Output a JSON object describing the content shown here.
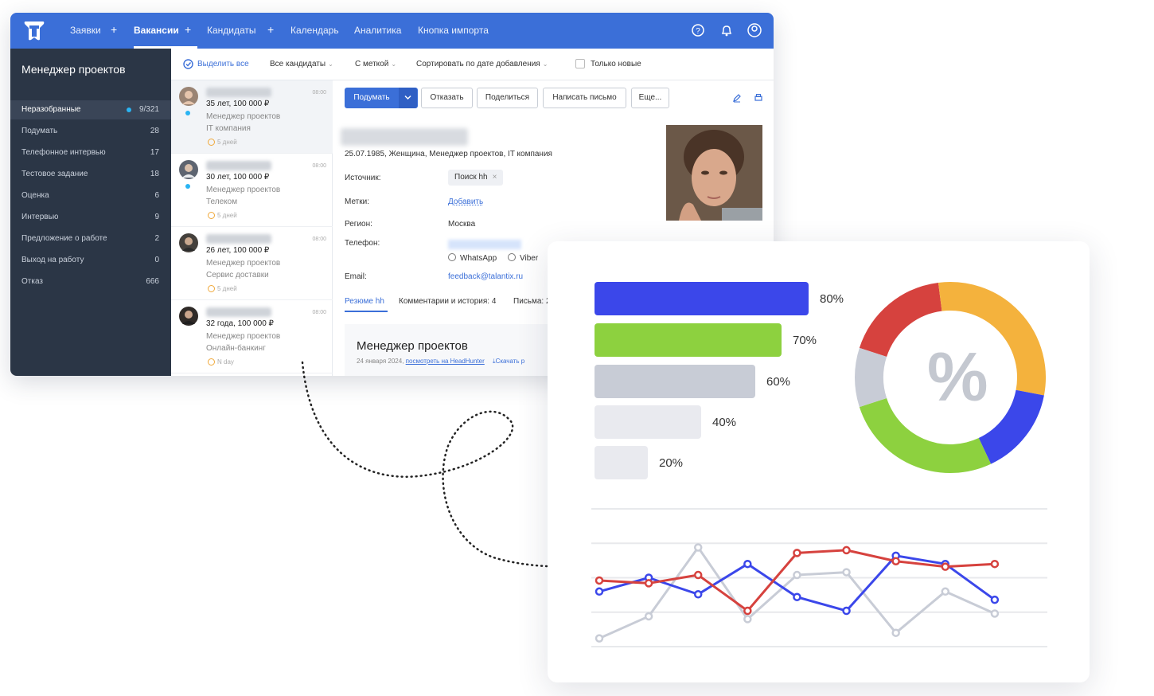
{
  "topnav": {
    "items": [
      "Заявки",
      "Вакансии",
      "Кандидаты",
      "Календарь",
      "Аналитика",
      "Кнопка импорта"
    ],
    "active": "Вакансии"
  },
  "sidebar": {
    "title": "Менеджер проектов",
    "items": [
      {
        "label": "Неразобранные",
        "count": "9/321"
      },
      {
        "label": "Подумать",
        "count": "28"
      },
      {
        "label": "Телефонное интервью",
        "count": "17"
      },
      {
        "label": "Тестовое задание",
        "count": "18"
      },
      {
        "label": "Оценка",
        "count": "6"
      },
      {
        "label": "Интервью",
        "count": "9"
      },
      {
        "label": "Предложение о работе",
        "count": "2"
      },
      {
        "label": "Выход на работу",
        "count": "0"
      },
      {
        "label": "Отказ",
        "count": "666"
      }
    ]
  },
  "toolbar": {
    "select_all": "Выделить все",
    "all_candidates": "Все кандидаты",
    "with_tag": "С меткой",
    "sort": "Сортировать по дате добавления",
    "only_new": "Только новые"
  },
  "candidates": [
    {
      "time": "08:00",
      "line1": "35 лет, 100 000 ₽",
      "position": "Менеджер проектов",
      "company": "IT компания",
      "age": "5 дней"
    },
    {
      "time": "08:00",
      "line1": "30 лет, 100 000 ₽",
      "position": "Менеджер проектов",
      "company": "Телеком",
      "age": "5 дней"
    },
    {
      "time": "08:00",
      "line1": "26 лет, 100 000 ₽",
      "position": "Менеджер проектов",
      "company": "Сервис доставки",
      "age": "5 дней"
    },
    {
      "time": "08:00",
      "line1": "32 года, 100 000 ₽",
      "position": "Менеджер проектов",
      "company": "Онлайн-банкинг",
      "age": "N day"
    }
  ],
  "actions": {
    "think": "Подумать",
    "reject": "Отказать",
    "share": "Поделиться",
    "write": "Написать письмо",
    "more": "Еще..."
  },
  "detail": {
    "meta": "25.07.1985, Женщина, Менеджер проектов, IT компания",
    "source_label": "Источник:",
    "source_value": "Поиск hh",
    "tags_label": "Метки:",
    "tags_add": "Добавить",
    "region_label": "Регион:",
    "region_value": "Москва",
    "phone_label": "Телефон:",
    "whatsapp": "WhatsApp",
    "viber": "Viber",
    "email_label": "Email:",
    "email_value": "feedback@talantix.ru",
    "tabs": [
      "Резюме hh",
      "Комментарии и история: 4",
      "Письма: 2"
    ],
    "resume_title": "Менеджер проектов",
    "resume_date": "24 января 2024,",
    "resume_link": "посмотреть на HeadHunter",
    "resume_download": "Скачать р"
  },
  "analytics": {
    "bars": [
      {
        "label": "80%",
        "value": 80,
        "color": "#3b47ea"
      },
      {
        "label": "70%",
        "value": 70,
        "color": "#8dd13f"
      },
      {
        "label": "60%",
        "value": 60,
        "color": "#c8ccd6"
      },
      {
        "label": "40%",
        "value": 40,
        "color": "#e9eaef"
      },
      {
        "label": "20%",
        "value": 20,
        "color": "#e9eaef"
      }
    ],
    "donut_symbol": "%",
    "donut": [
      {
        "value": 18,
        "color": "#d6423e"
      },
      {
        "value": 30,
        "color": "#f4b23d"
      },
      {
        "value": 15,
        "color": "#3b47ea"
      },
      {
        "value": 27,
        "color": "#8dd13f"
      },
      {
        "value": 10,
        "color": "#c8ccd6"
      }
    ]
  },
  "chart_data": {
    "type": "line",
    "x": [
      1,
      2,
      3,
      4,
      5,
      6,
      7,
      8,
      9,
      10
    ],
    "ylim": [
      0,
      5
    ],
    "grid": true,
    "series": [
      {
        "color": "#c8ccd6",
        "values": [
          0.3,
          1.1,
          3.6,
          1.0,
          2.6,
          2.7,
          0.5,
          2.0,
          1.2,
          null
        ]
      },
      {
        "color": "#3b47ea",
        "values": [
          2.0,
          2.5,
          1.9,
          3.0,
          1.8,
          1.3,
          3.3,
          3.0,
          1.7,
          null
        ]
      },
      {
        "color": "#d6423e",
        "values": [
          2.4,
          2.3,
          2.6,
          1.3,
          3.4,
          3.5,
          3.1,
          2.9,
          3.0,
          null
        ]
      }
    ]
  }
}
